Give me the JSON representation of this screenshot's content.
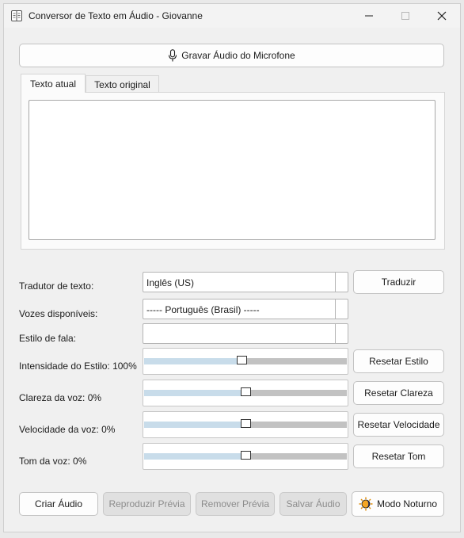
{
  "window": {
    "title": "Conversor de Texto em Áudio - Giovanne"
  },
  "record_button": {
    "label": "Gravar Áudio do Microfone",
    "icon": "microphone-icon"
  },
  "tabs": [
    {
      "label": "Texto atual",
      "active": true
    },
    {
      "label": "Texto original",
      "active": false
    }
  ],
  "text_area": {
    "value": ""
  },
  "translator": {
    "label": "Tradutor de texto:",
    "selected": "Inglês (US)",
    "button": "Traduzir"
  },
  "voices": {
    "label": "Vozes disponíveis:",
    "selected": "----- Português (Brasil) -----"
  },
  "speech_style": {
    "label": "Estilo de fala:",
    "selected": ""
  },
  "sliders": [
    {
      "label": "Intensidade do Estilo: 100%",
      "value_fraction": 0.48,
      "button": "Resetar Estilo"
    },
    {
      "label": "Clareza da voz: 0%",
      "value_fraction": 0.5,
      "button": "Resetar Clareza"
    },
    {
      "label": "Velocidade da voz: 0%",
      "value_fraction": 0.5,
      "button": "Resetar Velocidade"
    },
    {
      "label": "Tom da voz: 0%",
      "value_fraction": 0.5,
      "button": "Resetar Tom"
    }
  ],
  "bottom_buttons": {
    "create": "Criar Áudio",
    "play_preview": "Reproduzir Prévia",
    "remove_preview": "Remover Prévia",
    "save_audio": "Salvar Áudio",
    "night_mode": "Modo Noturno"
  },
  "colors": {
    "slider_fill": "#c8dcea",
    "slider_track": "#c2c2c2",
    "disabled_text": "#8c8c8c"
  }
}
